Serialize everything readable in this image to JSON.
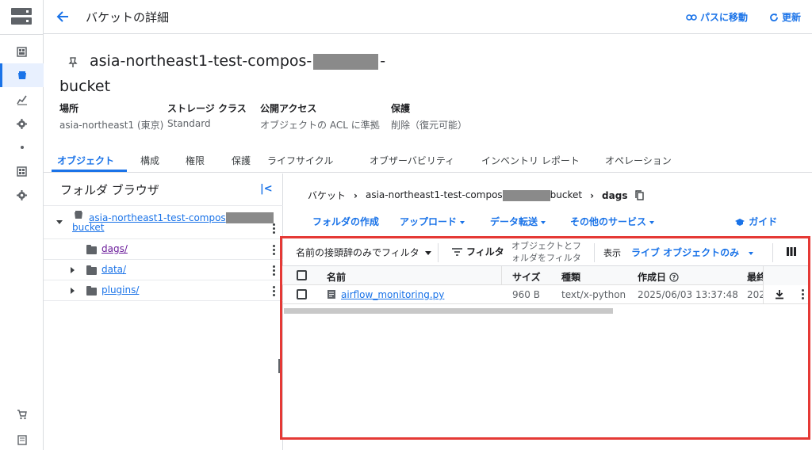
{
  "header": {
    "title": "バケットの詳細",
    "goto_path": "パスに移動",
    "refresh": "更新"
  },
  "bucket": {
    "name_part1": "asia-northeast1-test-compos-",
    "name_part2": "-",
    "name_line2": "bucket"
  },
  "properties": [
    {
      "label": "場所",
      "value": "asia-northeast1 (東京)"
    },
    {
      "label": "ストレージ クラス",
      "value": "Standard"
    },
    {
      "label": "公開アクセス",
      "value": "オブジェクトの ACL に準拠"
    },
    {
      "label": "保護",
      "value": "削除（復元可能）"
    }
  ],
  "tabs": [
    "オブジェクト",
    "構成",
    "権限",
    "保護",
    "ライフサイクル",
    "オブザーバビリティ",
    "インベントリ レポート",
    "オペレーション"
  ],
  "folder_browser": {
    "title": "フォルダ ブラウザ",
    "root_part1": "asia-northeast1-test-compos",
    "root_part2": "bucket",
    "folders": [
      "dags/",
      "data/",
      "plugins/"
    ]
  },
  "breadcrumb": {
    "root": "バケット",
    "bucket_part1": "asia-northeast1-test-compos",
    "bucket_part2": "bucket",
    "current": "dags"
  },
  "actions": {
    "create_folder": "フォルダの作成",
    "upload": "アップロード",
    "transfer": "データ転送",
    "other_services": "その他のサービス",
    "guide": "ガイド"
  },
  "filter_bar": {
    "prefix_filter": "名前の接頭辞のみでフィルタ",
    "filter": "フィルタ",
    "filter_hint_line1": "オブジェクトとフ",
    "filter_hint_line2": "ォルダをフィルタ",
    "display_label": "表示",
    "display_value": "ライブ オブジェクトのみ"
  },
  "table": {
    "columns": [
      "名前",
      "サイズ",
      "種類",
      "作成日",
      "最終"
    ],
    "rows": [
      {
        "name": "airflow_monitoring.py",
        "size": "960 B",
        "type": "text/x-python",
        "created": "2025/06/03 13:37:48",
        "last": "202"
      }
    ]
  }
}
